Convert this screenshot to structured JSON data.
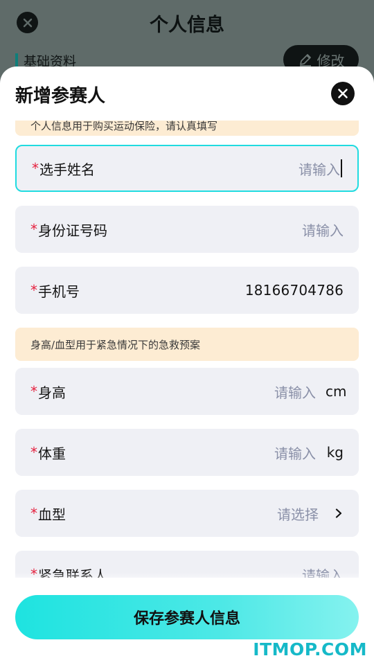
{
  "background": {
    "title": "个人信息",
    "section_label": "基础资料",
    "edit_label": "修改"
  },
  "sheet": {
    "title": "新增参赛人",
    "notice_top": "个人信息用于购买运动保险，请认真填写",
    "notice_health": "身高/血型用于紧急情况下的急救预案",
    "fields": [
      {
        "label": "选手姓名",
        "required": "*",
        "placeholder": "请输入",
        "value": ""
      },
      {
        "label": "身份证号码",
        "required": "*",
        "placeholder": "请输入",
        "value": ""
      },
      {
        "label": "手机号",
        "required": "*",
        "placeholder": "",
        "value": "18166704786"
      },
      {
        "label": "身高",
        "required": "*",
        "placeholder": "请输入",
        "unit": "cm"
      },
      {
        "label": "体重",
        "required": "*",
        "placeholder": "请输入",
        "unit": "kg"
      },
      {
        "label": "血型",
        "required": "*",
        "placeholder": "请选择"
      },
      {
        "label": "紧急联系人",
        "required": "*",
        "placeholder": "请输入"
      }
    ],
    "save_label": "保存参赛人信息"
  },
  "watermark": "ITMOP.COM",
  "colors": {
    "accent": "#20dbe0",
    "required": "#e5223f",
    "notice_bg": "#fdecd3",
    "field_bg": "#eff0f5"
  }
}
